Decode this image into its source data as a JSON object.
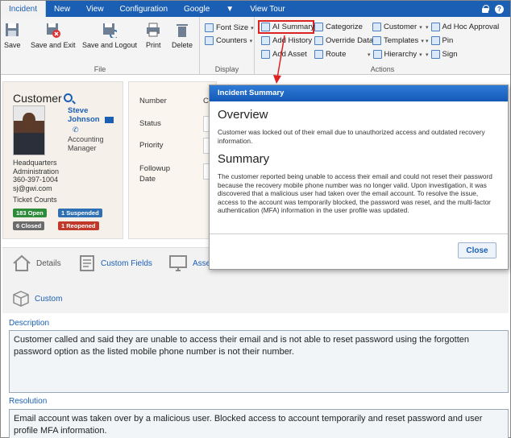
{
  "menu": {
    "items": [
      "Incident",
      "New",
      "View",
      "Configuration",
      "Google",
      "View Tour"
    ],
    "active": "Incident"
  },
  "ribbon": {
    "file": {
      "label": "File",
      "buttons": [
        "Save",
        "Save and Exit",
        "Save and Logout",
        "Print",
        "Delete"
      ]
    },
    "display": {
      "label": "Display",
      "buttons": [
        "Font Size",
        "Counters"
      ]
    },
    "actions": {
      "label": "Actions",
      "col1": [
        "AI Summary",
        "Add History",
        "Add Asset"
      ],
      "col2": [
        "Categorize",
        "Override Data",
        "Route"
      ],
      "col3": [
        "Customer",
        "Templates",
        "Hierarchy"
      ],
      "col4": [
        "Ad Hoc Approval",
        "Pin",
        "Sign"
      ]
    }
  },
  "customer": {
    "title": "Customer",
    "first_name": "Steve",
    "last_name": "Johnson",
    "role": "Accounting Manager",
    "location": "Headquarters",
    "department": "Administration",
    "phone": "360-397-1004",
    "email": "sj@gwi.com",
    "ticket_counts_label": "Ticket Counts",
    "badges": {
      "open": "183 Open",
      "suspended": "1 Suspended",
      "closed": "6 Closed",
      "reopened": "1 Reopened"
    }
  },
  "form": {
    "number_label": "Number",
    "number_value_partial": "C",
    "status_label": "Status",
    "priority_label": "Priority",
    "followup_label_line1": "Followup",
    "followup_label_line2": "Date"
  },
  "tabs": {
    "details": "Details",
    "custom_fields": "Custom Fields",
    "assets_partial": "Asse",
    "custom": "Custom"
  },
  "description": {
    "label": "Description",
    "text": "Customer called and said they are unable to access their email and is not able to reset password using the forgotten password option as the listed mobile phone number is not their number."
  },
  "resolution": {
    "label": "Resolution",
    "text": "Email account was taken over by a malicious user.  Blocked access to account temporarily and reset password and user profile MFA information."
  },
  "modal": {
    "title": "Incident Summary",
    "overview_heading": "Overview",
    "overview_text": "Customer was locked out of their email due to unauthorized access and outdated recovery information.",
    "summary_heading": "Summary",
    "summary_text": "The customer reported being unable to access their email and could not reset their password because the recovery mobile phone number was no longer valid. Upon investigation, it was discovered that a malicious user had taken over the email account. To resolve the issue, access to the account was temporarily blocked, the password was reset, and the multi-factor authentication (MFA) information in the user profile was updated.",
    "close_label": "Close"
  },
  "colors": {
    "menu_blue": "#1a5fb4",
    "highlight_red": "#dd2222",
    "badge_open": "#2e8b3a",
    "badge_suspended": "#2f6fb3",
    "badge_closed": "#6b6b6b",
    "badge_reopened": "#c0392b"
  }
}
